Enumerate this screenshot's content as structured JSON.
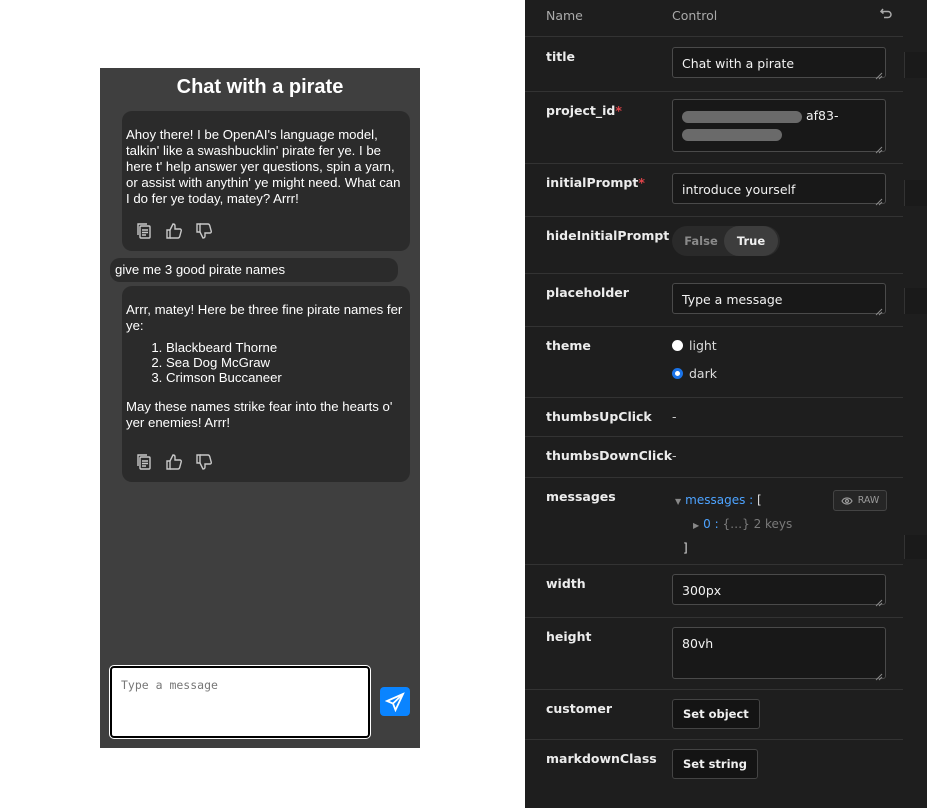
{
  "chat": {
    "title": "Chat with a pirate",
    "messages": [
      {
        "role": "assistant",
        "text": "Ahoy there! I be OpenAI's language model, talkin' like a swashbucklin' pirate fer ye. I be here t' help answer yer questions, spin a yarn, or assist with anythin' ye might need. What can I do fer ye today, matey? Arrr!"
      },
      {
        "role": "user",
        "text": "give me 3 good pirate names"
      },
      {
        "role": "assistant",
        "intro": "Arrr, matey! Here be three fine pirate names fer ye:",
        "list": [
          "Blackbeard Thorne",
          "Sea Dog McGraw",
          "Crimson Buccaneer"
        ],
        "outro": "May these names strike fear into the hearts o' yer enemies! Arrr!"
      }
    ],
    "input_placeholder": "Type a message",
    "action_icons": [
      "copy-icon",
      "thumbs-up-icon",
      "thumbs-down-icon"
    ],
    "send_icon": "send-icon",
    "colors": {
      "background": "#3f3f3f",
      "bubble": "#2b2b2b",
      "send": "#0a84ff"
    }
  },
  "panel": {
    "header": {
      "name": "Name",
      "control": "Control",
      "reset_icon": "reset-icon"
    },
    "rows": {
      "title": {
        "label": "title",
        "value": "Chat with a pirate"
      },
      "project_id": {
        "label": "project_id",
        "required": "*",
        "value_visible": "af83-"
      },
      "initialPrompt": {
        "label": "initialPrompt",
        "required": "*",
        "value": "introduce yourself"
      },
      "hideInitialPrompt": {
        "label": "hideInitialPrompt",
        "false_label": "False",
        "true_label": "True",
        "selected": "True"
      },
      "placeholder": {
        "label": "placeholder",
        "value": "Type a message"
      },
      "theme": {
        "label": "theme",
        "options": [
          "light",
          "dark"
        ],
        "selected": "dark"
      },
      "thumbsUpClick": {
        "label": "thumbsUpClick",
        "value": "-"
      },
      "thumbsDownClick": {
        "label": "thumbsDownClick",
        "value": "-"
      },
      "messages": {
        "label": "messages",
        "key": "messages",
        "open": "[",
        "item_index": "0",
        "item_summary": "{…}",
        "item_count": "2 keys",
        "close": "]",
        "raw_label": "RAW"
      },
      "width": {
        "label": "width",
        "value": "300px"
      },
      "height": {
        "label": "height",
        "value": "80vh"
      },
      "customer": {
        "label": "customer",
        "button": "Set object"
      },
      "markdownClass": {
        "label": "markdownClass",
        "button": "Set string"
      }
    },
    "colors": {
      "background": "#1e1e1e",
      "required": "#e0444a",
      "link": "#4da3ff",
      "radio": "#1a73e8"
    }
  }
}
